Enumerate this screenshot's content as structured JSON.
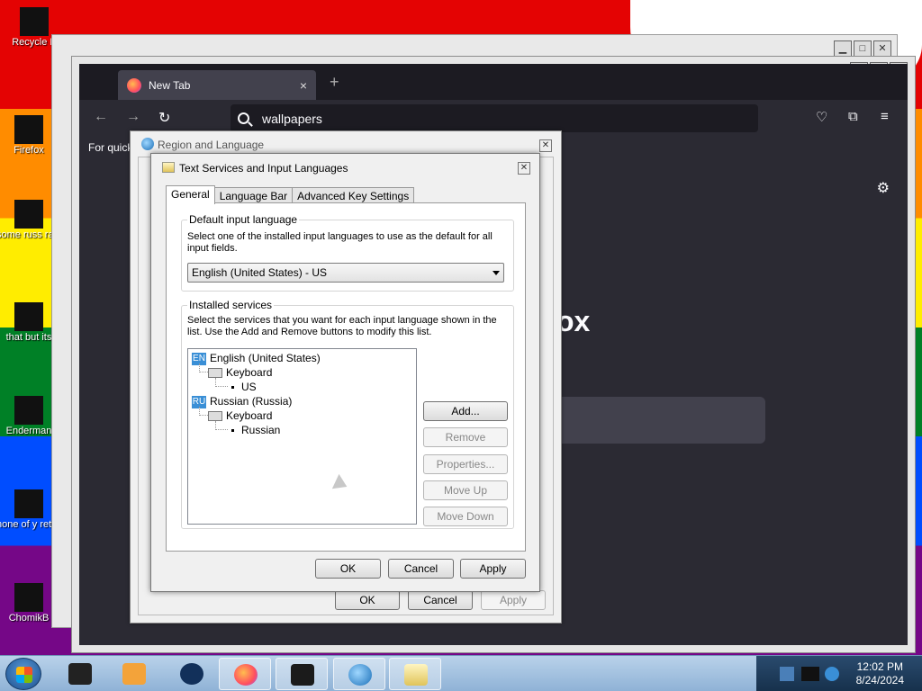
{
  "desktop": {
    "icons": [
      {
        "label": "Recycle B"
      },
      {
        "label": "Firefox"
      },
      {
        "label": "some russ ran a ra"
      },
      {
        "label": "that but its"
      },
      {
        "label": "Enderman"
      },
      {
        "label": "none of y retards kn"
      },
      {
        "label": "ChomikB"
      }
    ]
  },
  "firefox": {
    "tab_title": "New Tab",
    "tab_close": "×",
    "new_tab": "+",
    "back": "←",
    "forward": "→",
    "reload": "↻",
    "url_value": "wallpapers",
    "bookmarks_text": "For quick",
    "logo_text": "ox",
    "gear": "⚙",
    "pocket": "♡",
    "extensions": "⧉",
    "menu": "≡"
  },
  "region_dialog": {
    "title": "Region and Language",
    "ok": "OK",
    "cancel": "Cancel",
    "apply": "Apply"
  },
  "text_services": {
    "title": "Text Services and Input Languages",
    "tabs": [
      {
        "label": "General"
      },
      {
        "label": "Language Bar"
      },
      {
        "label": "Advanced Key Settings"
      }
    ],
    "default_input": {
      "label": "Default input language",
      "description": "Select one of the installed input languages to use as the default for all input fields.",
      "selected": "English (United States) - US"
    },
    "installed_services": {
      "label": "Installed services",
      "description": "Select the services that you want for each input language shown in the list. Use the Add and Remove buttons to modify this list.",
      "tree": [
        {
          "badge": "EN",
          "language": "English (United States)",
          "group": "Keyboard",
          "layout": "US"
        },
        {
          "badge": "RU",
          "language": "Russian (Russia)",
          "group": "Keyboard",
          "layout": "Russian"
        }
      ],
      "buttons": {
        "add": "Add...",
        "remove": "Remove",
        "properties": "Properties...",
        "move_up": "Move Up",
        "move_down": "Move Down"
      }
    },
    "ok": "OK",
    "cancel": "Cancel",
    "apply": "Apply"
  },
  "taskbar": {
    "time": "12:02 PM",
    "date": "8/24/2024"
  }
}
